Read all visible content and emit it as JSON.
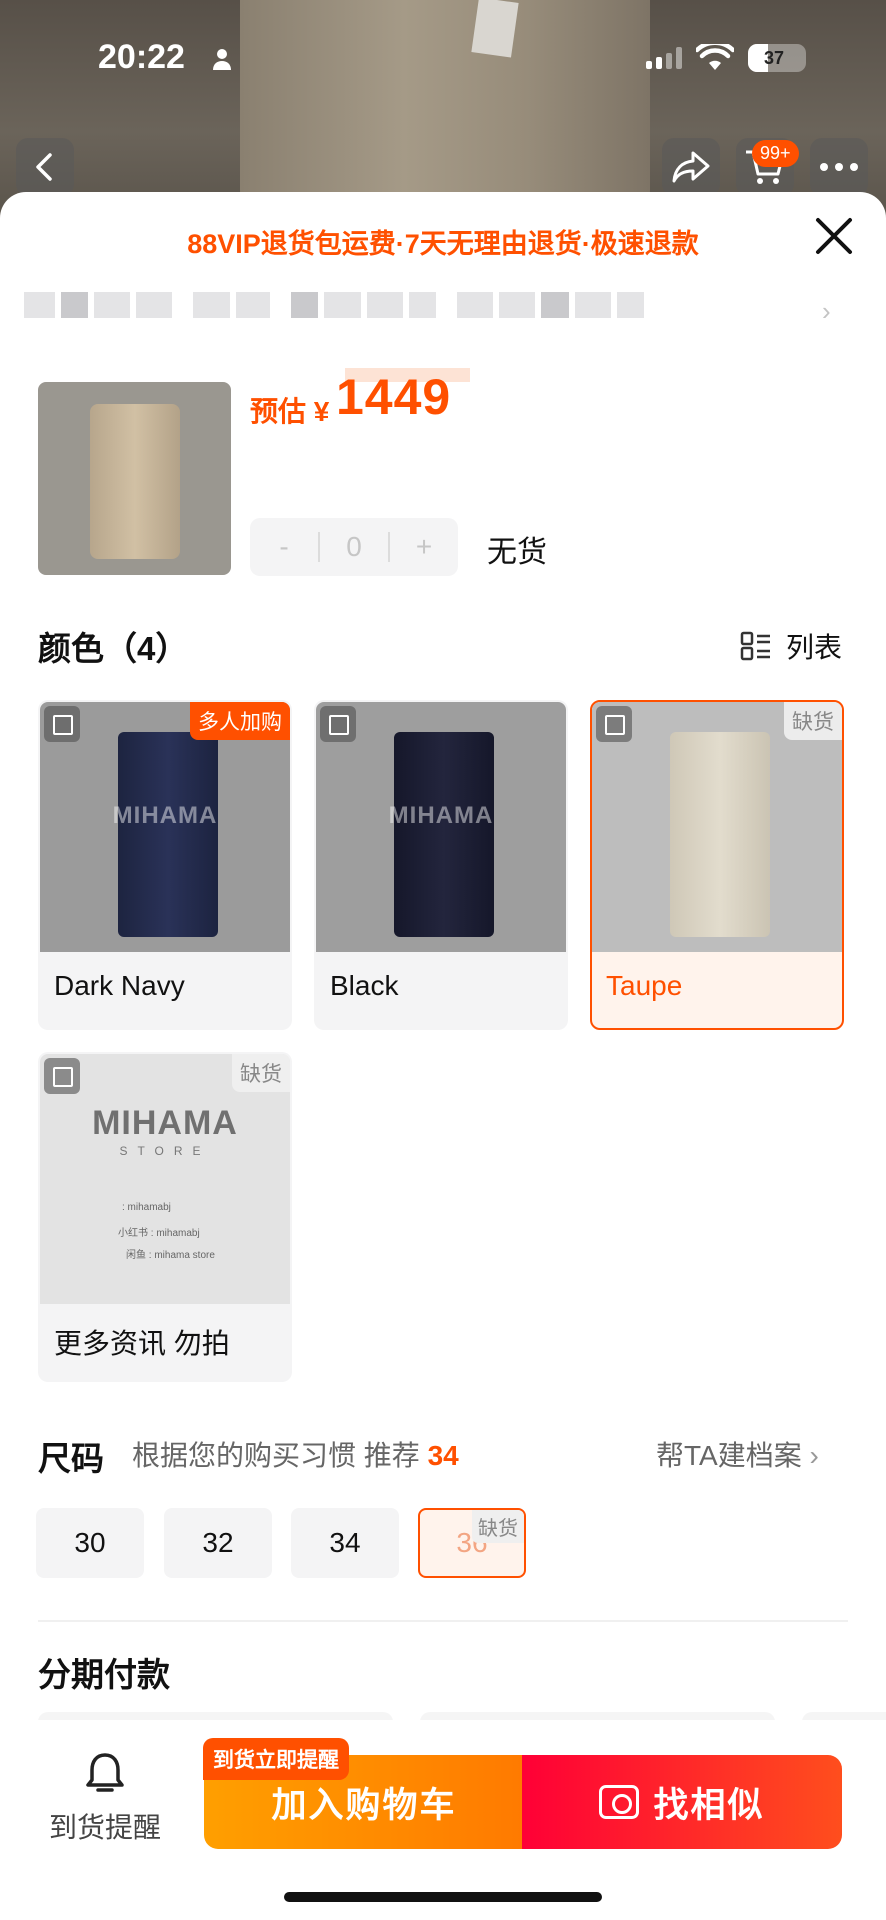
{
  "status_bar": {
    "time": "20:22",
    "battery": "37"
  },
  "top_nav": {
    "cart_badge": "99+"
  },
  "sheet": {
    "promo": "88VIP退货包运费·7天无理由退货·极速退款",
    "close_symbol": "✕",
    "price_prefix": "预估 ¥",
    "price": "1449",
    "stepper": {
      "minus": "-",
      "value": "0",
      "plus": "+"
    },
    "stock_status": "无货"
  },
  "color_section": {
    "title": "颜色（4）",
    "view_toggle": "列表",
    "options": [
      {
        "label": "Dark Navy",
        "badge": "多人加购",
        "watermark": "MIHAMA"
      },
      {
        "label": "Black",
        "badge": "",
        "watermark": "MIHAMA"
      },
      {
        "label": "Taupe",
        "badge": "缺货",
        "watermark": ""
      },
      {
        "label": "更多资讯 勿拍",
        "badge": "缺货",
        "watermark": ""
      }
    ],
    "info_card": {
      "brand": "MIHAMA",
      "store": "STORE",
      "lines": [
        ": mihamabj",
        "小红书 : mihamabj",
        "闲鱼 : mihama store"
      ]
    }
  },
  "size_section": {
    "title": "尺码",
    "hint_prefix": "根据您的购买习惯 推荐",
    "recommended": "34",
    "profile_link": "帮TA建档案",
    "sizes": [
      {
        "label": "30",
        "badge": ""
      },
      {
        "label": "32",
        "badge": ""
      },
      {
        "label": "34",
        "badge": ""
      },
      {
        "label": "36",
        "badge": "缺货"
      }
    ]
  },
  "installment_section": {
    "title": "分期付款"
  },
  "bottom_bar": {
    "notify_label": "到货提醒",
    "cta_tag": "到货立即提醒",
    "add_to_cart": "加入购物车",
    "find_similar": "找相似"
  },
  "colors": {
    "accent": "#ff5000",
    "cart_gradient": [
      "#ff9f00",
      "#ff7a00"
    ],
    "similar_gradient": [
      "#ff0036",
      "#ff4e1d"
    ]
  }
}
